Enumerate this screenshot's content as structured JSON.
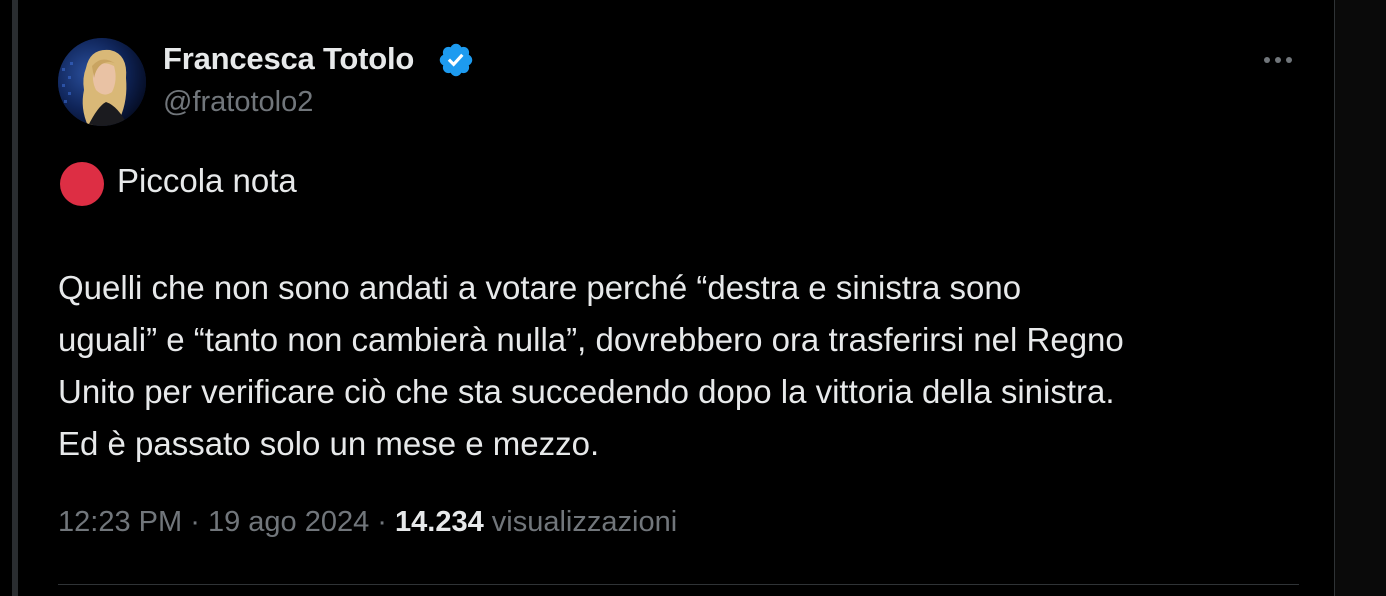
{
  "author": {
    "display_name": "Francesca Totolo",
    "handle": "@fratotolo2",
    "verified": true,
    "verified_color": "#1d9bf0"
  },
  "tweet": {
    "note_icon": "red-circle",
    "note_color": "#dd2e44",
    "note_label": "Piccola nota",
    "body_lines": [
      "Quelli che non sono andati a votare perché “destra e sinistra sono",
      "uguali” e “tanto non cambierà nulla”, dovrebbero ora trasferirsi nel Regno",
      "Unito per verificare ciò che sta succedendo dopo la vittoria della sinistra.",
      "Ed è passato solo un mese e mezzo."
    ]
  },
  "meta": {
    "time": "12:23 PM",
    "separator": "·",
    "date": "19 ago 2024",
    "views_count": "14.234",
    "views_label": "visualizzazioni"
  },
  "icons": {
    "more": "more-horizontal-icon",
    "verified": "verified-badge-icon"
  }
}
